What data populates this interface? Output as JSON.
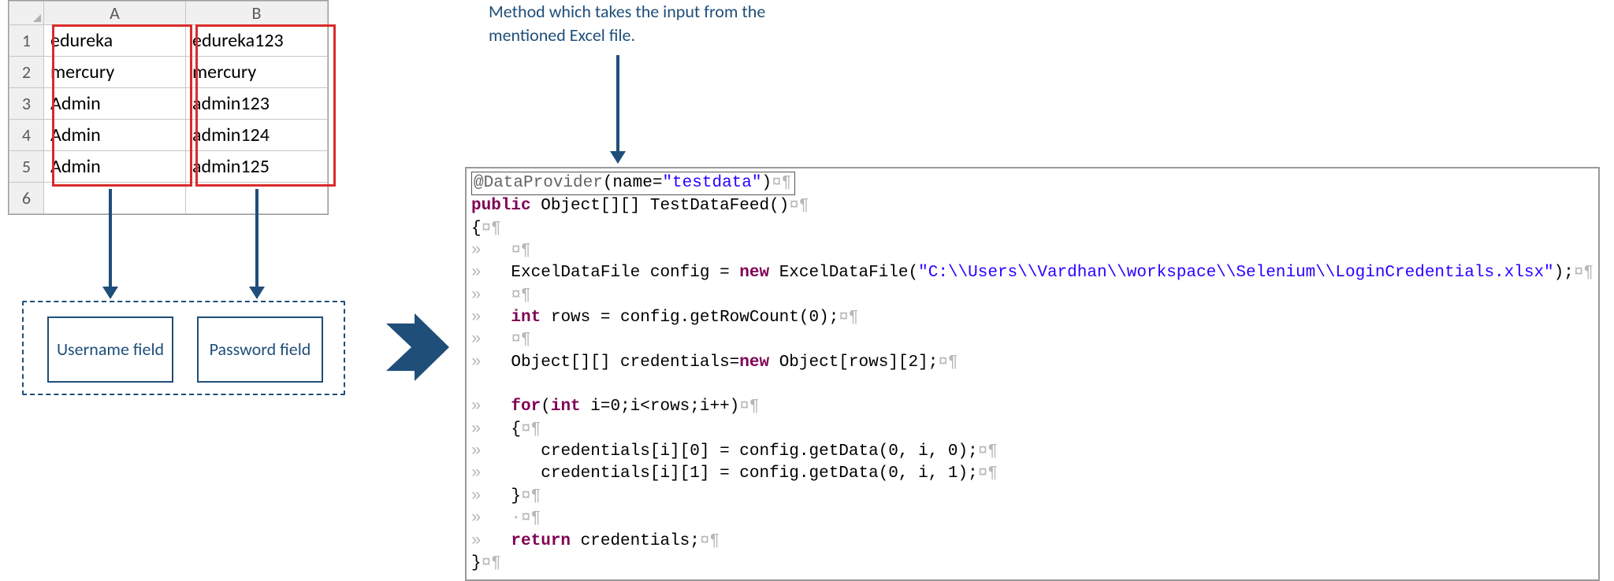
{
  "caption": "Method which takes the input from the mentioned Excel file.",
  "excel": {
    "columns": [
      "A",
      "B"
    ],
    "row_labels": [
      "1",
      "2",
      "3",
      "4",
      "5",
      "6"
    ],
    "rows": [
      [
        "edureka",
        "edureka123"
      ],
      [
        "mercury",
        "mercury"
      ],
      [
        "Admin",
        "admin123"
      ],
      [
        "Admin",
        "admin124"
      ],
      [
        "Admin",
        "admin125"
      ],
      [
        "",
        ""
      ]
    ]
  },
  "fields": {
    "username": "Username field",
    "password": "Password field"
  },
  "code": {
    "annotation_prefix": "@DataProvider",
    "annotation_args_open": "(name=",
    "annotation_name_value": "\"testdata\"",
    "annotation_args_close": ")",
    "kw_public": "public",
    "sig_rest": " Object[][] TestDataFeed()",
    "brace_open": "{",
    "excel_line_a": "ExcelDataFile config = ",
    "kw_new": "new",
    "excel_line_b": " ExcelDataFile(",
    "excel_path": "\"C:\\\\Users\\\\Vardhan\\\\workspace\\\\Selenium\\\\LoginCredentials.xlsx\"",
    "excel_line_c": ");",
    "kw_int": "int",
    "rows_line": " rows = config.getRowCount(0);",
    "obj_line_a": "Object[][] credentials=",
    "obj_line_b": " Object[rows][2];",
    "kw_for": "for",
    "for_open": "(",
    "for_rest": " i=0;i<rows;i++)",
    "loop_open": "{",
    "cred0": "credentials[i][0] = config.getData(0, i, 0);",
    "cred1": "credentials[i][1] = config.getData(0, i, 1);",
    "loop_close": "}",
    "dot": ".",
    "kw_return": "return",
    "return_rest": " credentials;",
    "brace_close": "}"
  },
  "glyphs": {
    "tab": "»",
    "space": "·",
    "para": "¤¶"
  }
}
